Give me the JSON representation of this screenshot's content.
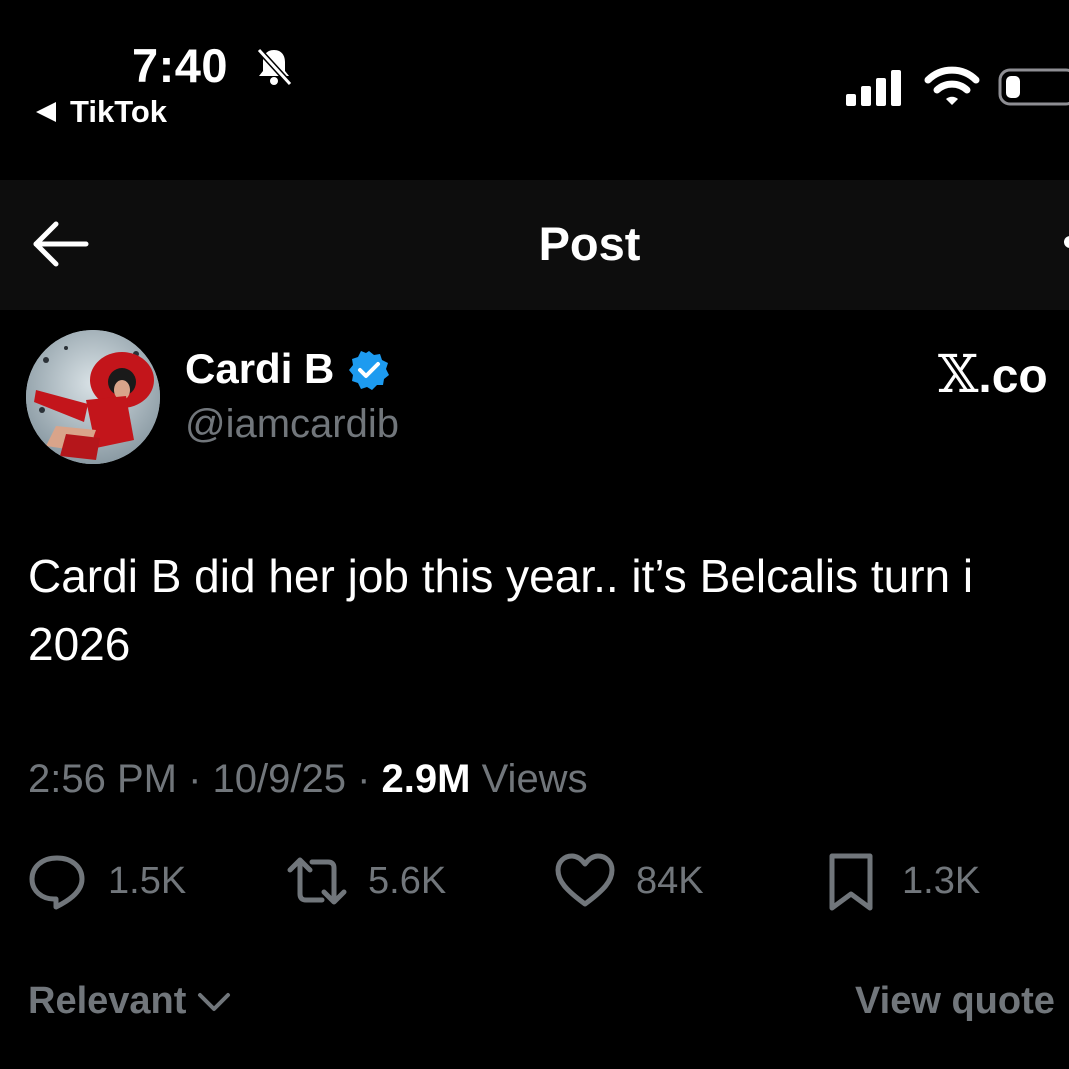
{
  "status_bar": {
    "time": "7:40",
    "back_app_label": "TikTok",
    "icons": [
      "bell-slash-icon",
      "cellular-signal-icon",
      "wifi-icon",
      "battery-icon"
    ]
  },
  "header": {
    "title": "Post",
    "back_icon": "arrow-left-icon"
  },
  "post": {
    "author_name": "Cardi B",
    "author_handle": "@iamcardib",
    "verified": true,
    "watermark_x": "𝕏",
    "watermark_suffix": ".co",
    "text": "Cardi B did her job this year.. it’s Belcalis turn i\n2026",
    "time": "2:56 PM",
    "date": "10/9/25",
    "separator": " · ",
    "views_count": "2.9M",
    "views_label": "Views"
  },
  "actions": [
    {
      "name": "reply",
      "icon": "reply-bubble-icon",
      "count": "1.5K"
    },
    {
      "name": "repost",
      "icon": "repost-icon",
      "count": "5.6K"
    },
    {
      "name": "like",
      "icon": "heart-icon",
      "count": "84K"
    },
    {
      "name": "bookmark",
      "icon": "bookmark-icon",
      "count": "1.3K"
    }
  ],
  "footer": {
    "sort_label": "Relevant",
    "view_quotes_label": "View quote"
  },
  "colors": {
    "background": "#000000",
    "header_background": "#0d0d0d",
    "primary_text": "#ffffff",
    "secondary_text": "#71767b",
    "verified_blue": "#1d9bf0"
  }
}
